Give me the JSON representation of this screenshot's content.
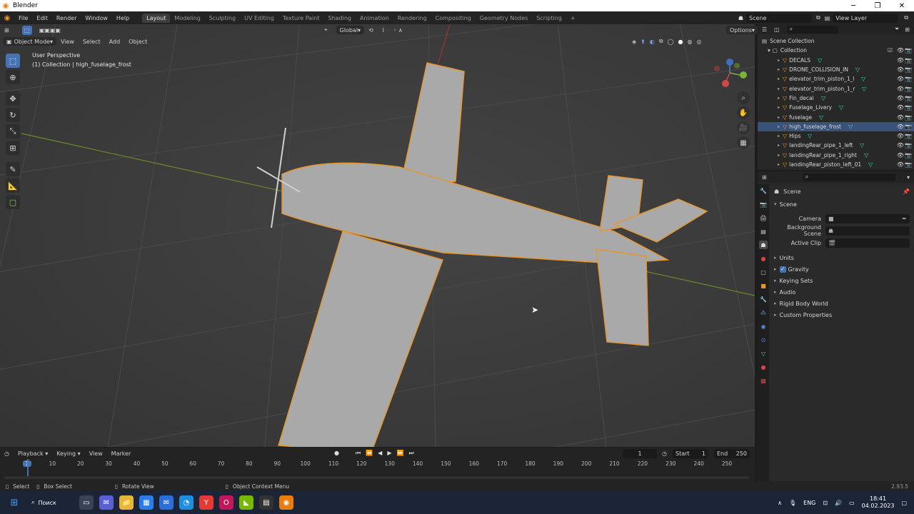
{
  "app": {
    "title": "Blender"
  },
  "menus": [
    "File",
    "Edit",
    "Render",
    "Window",
    "Help"
  ],
  "workspaces": [
    "Layout",
    "Modeling",
    "Sculpting",
    "UV Editing",
    "Texture Paint",
    "Shading",
    "Animation",
    "Rendering",
    "Compositing",
    "Geometry Nodes",
    "Scripting"
  ],
  "active_workspace": "Layout",
  "scene_field": "Scene",
  "view_layer_field": "View Layer",
  "viewport": {
    "mode": "Object Mode",
    "menu": [
      "View",
      "Select",
      "Add",
      "Object"
    ],
    "orientation": "Global",
    "options": "Options",
    "overlay_title": "User Perspective",
    "overlay_subtitle": "(1) Collection | high_fuselage_frost"
  },
  "outliner": {
    "root": "Scene Collection",
    "collection": "Collection",
    "items": [
      {
        "name": "DECALS",
        "selected": false
      },
      {
        "name": "DRONE_COLLISION_IN",
        "selected": false
      },
      {
        "name": "elevator_trim_piston_1_l",
        "selected": false
      },
      {
        "name": "elevator_trim_piston_1_r",
        "selected": false
      },
      {
        "name": "Fin_decal",
        "selected": false
      },
      {
        "name": "Fuselage_Livery",
        "selected": false
      },
      {
        "name": "fuselage",
        "selected": false
      },
      {
        "name": "high_fuselage_frost",
        "selected": true
      },
      {
        "name": "Hips",
        "selected": false
      },
      {
        "name": "landingRear_pipe_1_left",
        "selected": false
      },
      {
        "name": "landingRear_pipe_1_right",
        "selected": false
      },
      {
        "name": "landingRear_piston_left_01",
        "selected": false
      }
    ]
  },
  "properties": {
    "header": "Scene",
    "panel": "Scene",
    "fields": [
      {
        "label": "Camera"
      },
      {
        "label": "Background Scene"
      },
      {
        "label": "Active Clip"
      }
    ],
    "subpanels": [
      "Units",
      "Gravity",
      "Keying Sets",
      "Audio",
      "Rigid Body World",
      "Custom Properties"
    ],
    "gravity_checked": true
  },
  "timeline": {
    "menu": [
      "Playback",
      "Keying",
      "View",
      "Marker"
    ],
    "current_frame": "1",
    "start_label": "Start",
    "start": "1",
    "end_label": "End",
    "end": "250",
    "ruler": [
      "1",
      "10",
      "20",
      "30",
      "40",
      "50",
      "60",
      "70",
      "80",
      "90",
      "100",
      "110",
      "120",
      "130",
      "140",
      "150",
      "160",
      "170",
      "180",
      "190",
      "200",
      "210",
      "220",
      "230",
      "240",
      "250"
    ]
  },
  "status": {
    "select": "Select",
    "box_select": "Box Select",
    "rotate_view": "Rotate View",
    "context_menu": "Object Context Menu",
    "version": "2.93.5"
  },
  "taskbar": {
    "search": "Поиск",
    "lang": "ENG",
    "time": "18:41",
    "date": "04.02.2023"
  },
  "colors": {
    "accent": "#4772b3",
    "selection": "#e8962b",
    "mesh": "#3ddbbb"
  }
}
